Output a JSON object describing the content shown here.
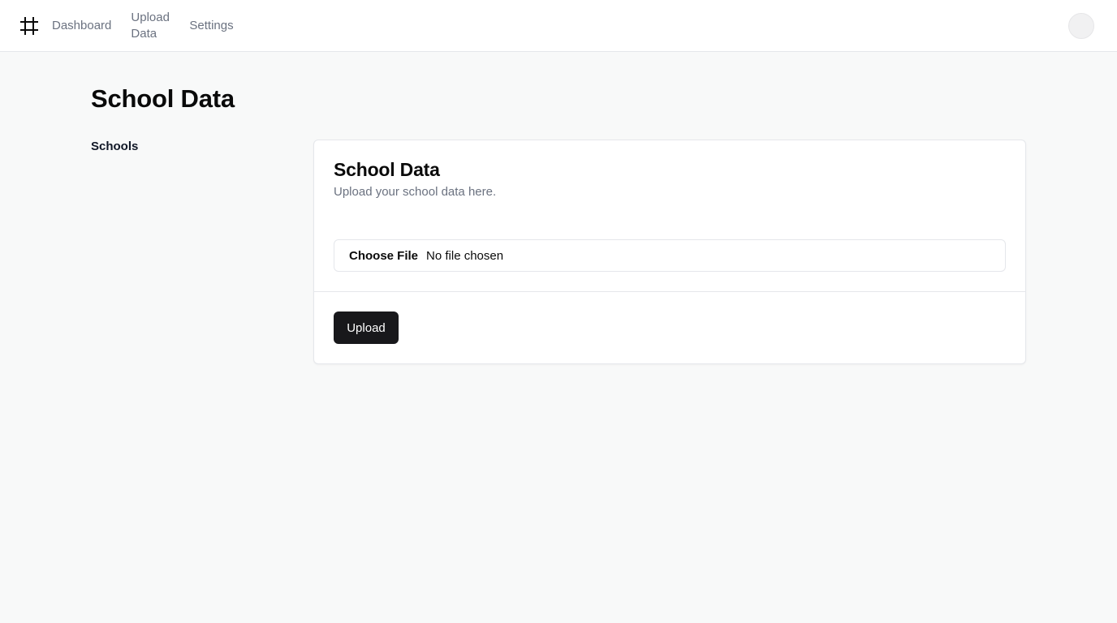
{
  "header": {
    "logo_icon": "hash-icon",
    "nav": [
      {
        "label": "Dashboard"
      },
      {
        "label": "Upload Data"
      },
      {
        "label": "Settings"
      }
    ]
  },
  "page": {
    "title": "School Data"
  },
  "sidebar": {
    "items": [
      {
        "label": "Schools"
      }
    ]
  },
  "card": {
    "title": "School Data",
    "description": "Upload your school data here.",
    "file_input": {
      "button_label": "Choose File",
      "status": "No file chosen"
    },
    "submit_label": "Upload"
  },
  "colors": {
    "background": "#f8f9f9",
    "primary_button": "#18181b",
    "muted_text": "#6b7280",
    "border": "#e5e7eb"
  }
}
